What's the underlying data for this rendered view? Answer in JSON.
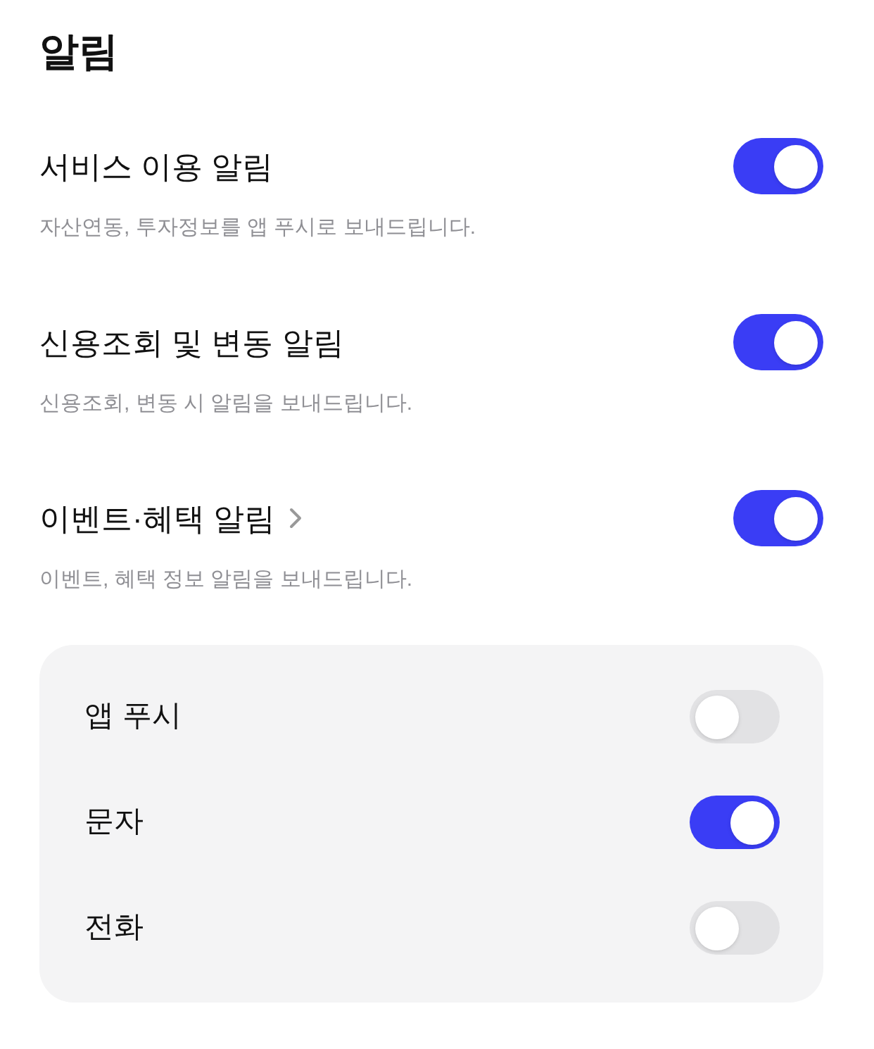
{
  "title": "알림",
  "settings": [
    {
      "label": "서비스 이용 알림",
      "description": "자산연동, 투자정보를 앱 푸시로 보내드립니다.",
      "on": true,
      "has_chevron": false
    },
    {
      "label": "신용조회 및 변동 알림",
      "description": "신용조회, 변동 시 알림을 보내드립니다.",
      "on": true,
      "has_chevron": false
    },
    {
      "label": "이벤트·혜택 알림",
      "description": "이벤트, 혜택 정보 알림을 보내드립니다.",
      "on": true,
      "has_chevron": true
    }
  ],
  "channels": [
    {
      "label": "앱 푸시",
      "on": false
    },
    {
      "label": "문자",
      "on": true
    },
    {
      "label": "전화",
      "on": false
    }
  ]
}
